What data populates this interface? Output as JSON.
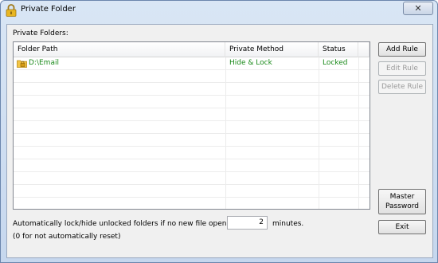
{
  "window": {
    "title": "Private Folder",
    "close_symbol": "✕"
  },
  "private_folders_label": "Private Folders:",
  "table": {
    "columns": [
      "Folder Path",
      "Private Method",
      "Status"
    ],
    "rows": [
      {
        "path": "D:\\Email",
        "method": "Hide & Lock",
        "status": "Locked",
        "color": "#1a8a1a"
      }
    ]
  },
  "buttons": {
    "add_rule": "Add Rule",
    "edit_rule": "Edit Rule",
    "delete_rule": "Delete Rule",
    "master_password_line1": "Master",
    "master_password_line2": "Password",
    "exit": "Exit"
  },
  "auto_lock": {
    "text": "Automatically lock/hide unlocked folders if no new file openned for",
    "minutes_value": "2",
    "minutes_label": "minutes.",
    "note": "(0 for not automatically reset)"
  }
}
